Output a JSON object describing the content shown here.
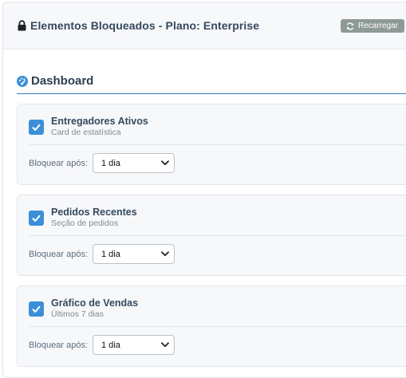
{
  "header": {
    "title": "Elementos Bloqueados - Plano: Enterprise",
    "reload_label": "Recarregar"
  },
  "section": {
    "title": "Dashboard",
    "icon": "dashboard-icon"
  },
  "items": [
    {
      "name": "Entregadores Ativos",
      "description": "Card de estatística",
      "checked": true,
      "lock_label": "Bloquear após:",
      "lock_value": "1 dia"
    },
    {
      "name": "Pedidos Recentes",
      "description": "Seção de pedidos",
      "checked": true,
      "lock_label": "Bloquear após:",
      "lock_value": "1 dia"
    },
    {
      "name": "Gráfico de Vendas",
      "description": "Últimos 7 dias",
      "checked": true,
      "lock_label": "Bloquear após:",
      "lock_value": "1 dia"
    }
  ],
  "colors": {
    "accent": "#3a8fd8",
    "reload_button": "#8e9a97",
    "section_rule": "#3a7bbf"
  }
}
